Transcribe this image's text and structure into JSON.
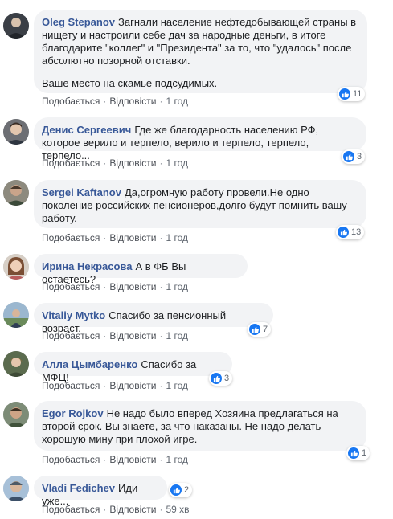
{
  "actions": {
    "like": "Подобається",
    "reply": "Відповісти",
    "separator": "·"
  },
  "comments": [
    {
      "author": "Oleg Stepanov",
      "text": "Загнали население нефтедобывающей страны в нищету и настроили себе дач за народные деньги, в итоге благодарите \"коллег\" и \"Президента\" за то, что \"удалось\" после абсолютно позорной отставки.",
      "text2": "Ваше место на скамье подсудимых.",
      "time": "1 год",
      "reactions": "11"
    },
    {
      "author": "Денис Сергеевич",
      "text": "Где же благодарность населению РФ, которое верило и терпело, верило и терпело, терпело, терпело...",
      "time": "1 год",
      "reactions": "3"
    },
    {
      "author": "Sergei Kaftanov",
      "text": "Да,огромную работу провели.Не одно поколение российских пенсионеров,долго будут помнить вашу работу.",
      "time": "1 год",
      "reactions": "13"
    },
    {
      "author": "Ирина Некрасова",
      "text": "А в ФБ Вы остаетесь?",
      "time": "1 год",
      "reactions": ""
    },
    {
      "author": "Vitaliy Mytko",
      "text": "Спасибо за пенсионный возраст.",
      "time": "1 год",
      "reactions": "7"
    },
    {
      "author": "Алла Цымбаренко",
      "text": "Спасибо за МФЦ!",
      "time": "1 год",
      "reactions": "3"
    },
    {
      "author": "Egor Rojkov",
      "text": "Не надо было вперед Хозяина предлагаться на второй срок. Вы знаете, за что наказаны. Не надо делать хорошую мину при плохой игре.",
      "time": "1 год",
      "reactions": "1"
    },
    {
      "author": "Vladi Fedichev",
      "text": "Иди уже...",
      "time": "59 хв",
      "reactions": "2"
    }
  ]
}
